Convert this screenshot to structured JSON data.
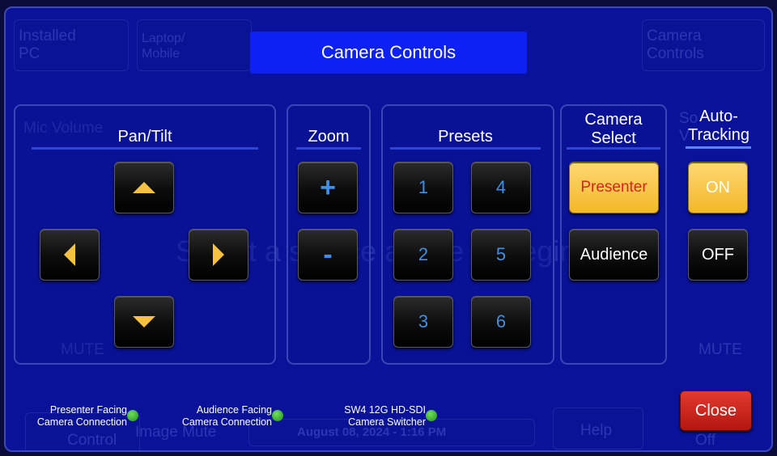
{
  "background": {
    "installed_pc": "Installed\nPC",
    "laptop_mobile": "Laptop/\nMobile",
    "camera_controls": "Camera\nControls",
    "mic_volume": "Mic Volume",
    "mute_left": "MUTE",
    "mute_right": "MUTE",
    "select_prompt": "Select a source above to begin",
    "sound_label": "So\nV",
    "control": "Control",
    "image_mute": "Image Mute",
    "datetime": "August 08, 2024 - 1:16 PM",
    "help": "Help",
    "off": "Off"
  },
  "title": "Camera Controls",
  "pan_tilt": {
    "title": "Pan/Tilt"
  },
  "zoom": {
    "title": "Zoom",
    "in_label": "+",
    "out_label": "-"
  },
  "presets": {
    "title": "Presets",
    "items": [
      "1",
      "2",
      "3",
      "4",
      "5",
      "6"
    ]
  },
  "camera_select": {
    "title_line1": "Camera",
    "title_line2": "Select",
    "presenter": "Presenter",
    "audience": "Audience"
  },
  "auto_tracking": {
    "title_line1": "Auto-",
    "title_line2": "Tracking",
    "on": "ON",
    "off": "OFF"
  },
  "status": {
    "presenter": {
      "line1": "Presenter Facing",
      "line2": "Camera Connection"
    },
    "audience": {
      "line1": "Audience Facing",
      "line2": "Camera Connection"
    },
    "switcher": {
      "line1": "SW4 12G HD-SDI",
      "line2": "Camera Switcher"
    }
  },
  "close_label": "Close",
  "colors": {
    "accent": "#0d21f5",
    "active": "#f2b928",
    "status_ok": "#3fbf2a"
  }
}
